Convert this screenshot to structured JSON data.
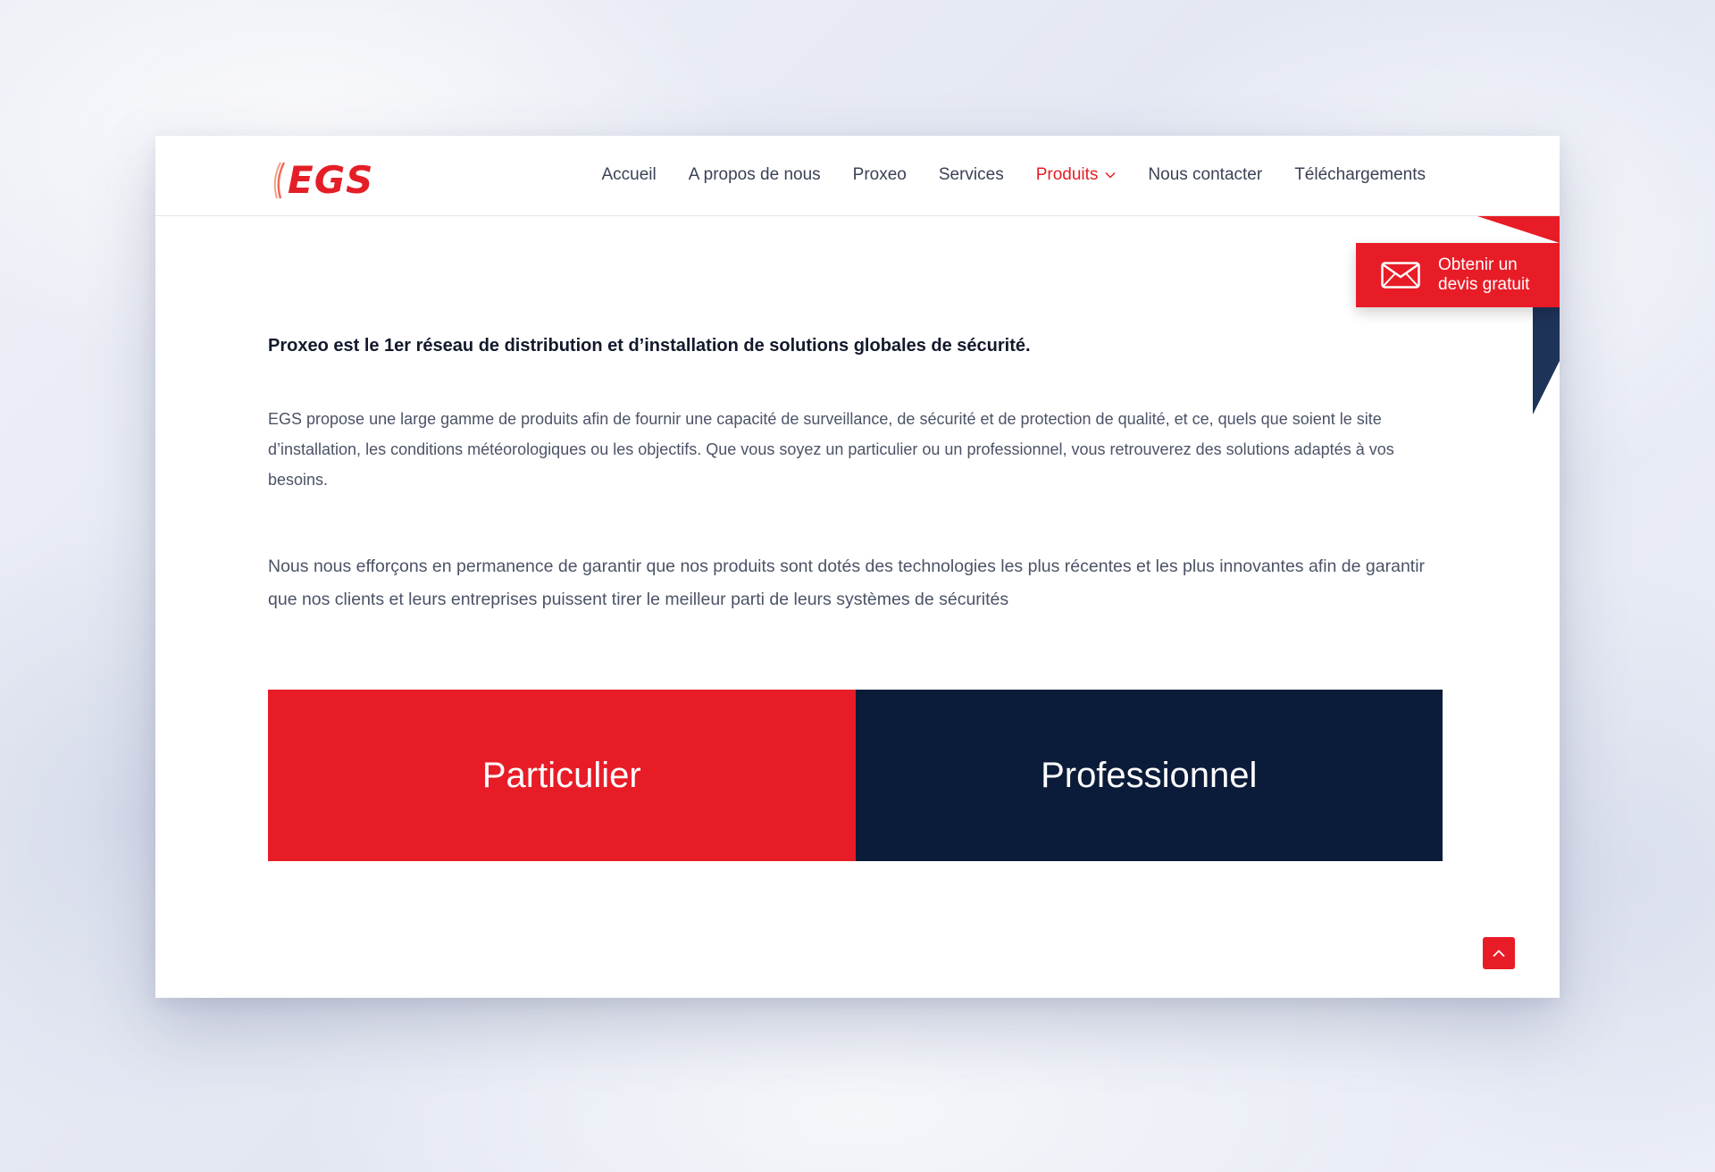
{
  "header": {
    "logo_text": "EGS",
    "nav": [
      {
        "label": "Accueil"
      },
      {
        "label": "A propos de nous"
      },
      {
        "label": "Proxeo"
      },
      {
        "label": "Services"
      },
      {
        "label": "Produits",
        "active": true,
        "has_dropdown": true
      },
      {
        "label": "Nous contacter"
      },
      {
        "label": "Téléchargements"
      }
    ]
  },
  "quote_button": {
    "icon": "envelope-icon",
    "line1": "Obtenir un",
    "line2": "devis gratuit"
  },
  "main": {
    "lead": "Proxeo est le 1er réseau de distribution et d’installation de solutions globales de sécurité.",
    "paragraph1": "EGS propose une large gamme de produits afin de fournir une capacité de surveillance, de sécurité et de protection de qualité, et ce, quels que soient le site d’installation, les conditions météorologiques ou les objectifs. Que vous soyez un particulier ou un professionnel, vous retrouverez des solutions adaptés à vos besoins.",
    "paragraph2": "Nous nous efforçons en permanence de garantir que nos produits sont dotés des technologies les plus récentes et les plus innovantes afin de garantir que nos clients et leurs entreprises puissent tirer le meilleur parti de leurs systèmes de sécurités",
    "cards": [
      {
        "label": "Particulier",
        "color": "#e81c27"
      },
      {
        "label": "Professionnel",
        "color": "#0b1c3a"
      }
    ]
  },
  "scroll_top": {
    "icon": "chevron-up-icon"
  },
  "colors": {
    "brand_red": "#e41e26",
    "navy": "#0b1c3a",
    "ribbon_navy": "#1d3358"
  }
}
